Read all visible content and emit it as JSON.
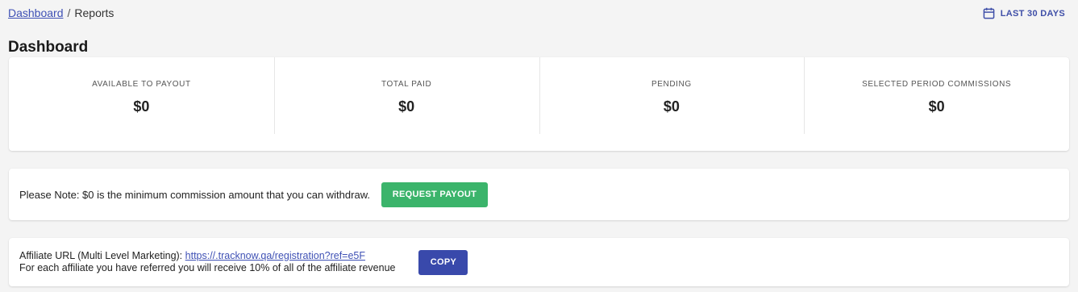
{
  "breadcrumb": {
    "link": "Dashboard",
    "separator": "/",
    "current": "Reports"
  },
  "date_range": {
    "label": "LAST 30 DAYS",
    "icon": "calendar-icon"
  },
  "page_title": "Dashboard",
  "stats": [
    {
      "label": "AVAILABLE TO PAYOUT",
      "value": "$0"
    },
    {
      "label": "TOTAL PAID",
      "value": "$0"
    },
    {
      "label": "PENDING",
      "value": "$0"
    },
    {
      "label": "SELECTED PERIOD COMMISSIONS",
      "value": "$0"
    }
  ],
  "note": {
    "text": "Please Note: $0 is the minimum commission amount that you can withdraw.",
    "button": "REQUEST PAYOUT"
  },
  "affiliate": {
    "label": "Affiliate URL (Multi Level Marketing):",
    "url": "https://.tracknow.qa/registration?ref=e5F",
    "description": "For each affiliate you have referred you will receive 10% of all of the affiliate revenue",
    "button": "COPY"
  },
  "colors": {
    "primary": "#3f51b5",
    "success": "#3bb46b",
    "copy": "#3949ab",
    "background": "#f4f4f4"
  }
}
